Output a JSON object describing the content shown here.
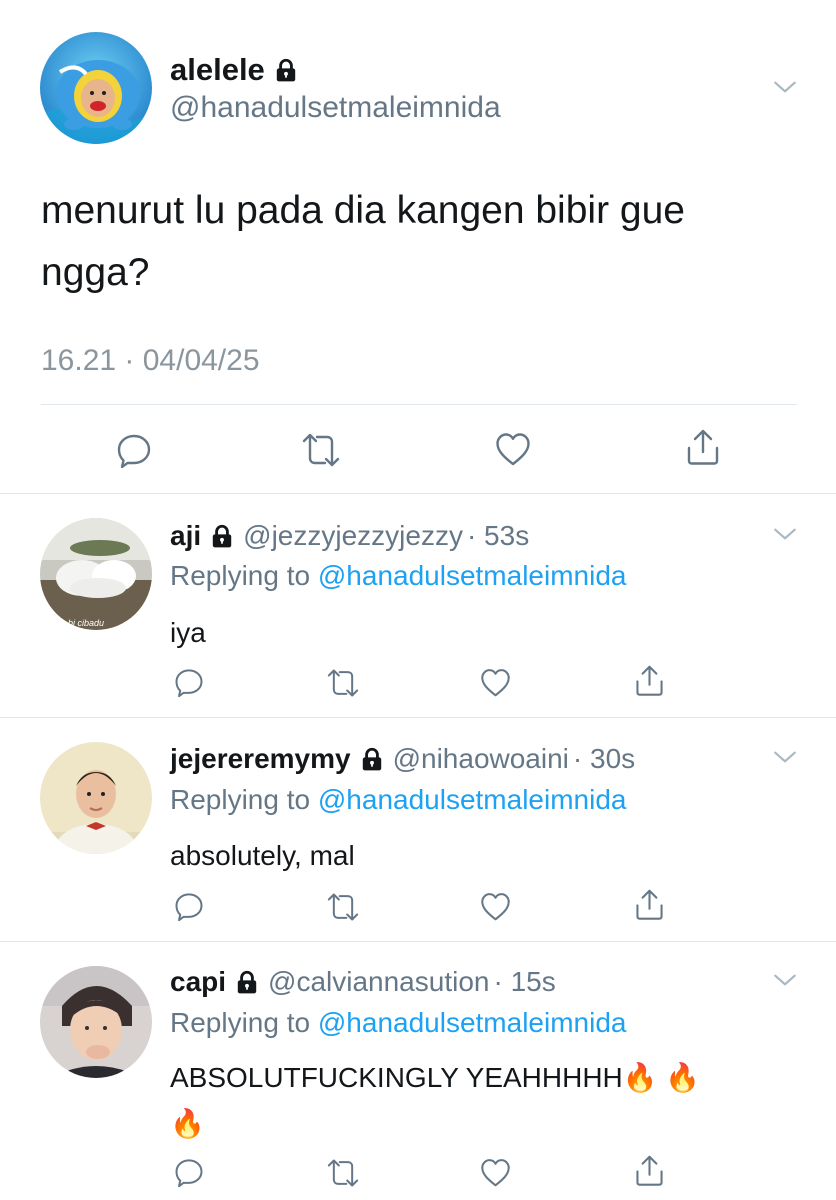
{
  "main_tweet": {
    "display_name": "alelele",
    "handle": "@hanadulsetmaleimnida",
    "text_line1": "menurut lu pada dia kangen bibir gue",
    "text_line2": "ngga?",
    "timestamp": "16.21 · 04/04/25"
  },
  "replies": [
    {
      "display_name": "aji",
      "handle": "@jezzyjezzyjezzy",
      "time": "· 53s",
      "replying_label": "Replying to",
      "replying_to": "@hanadulsetmaleimnida",
      "text_line1": "iya",
      "text_line2": "",
      "avatar_caption": "bi cibadu"
    },
    {
      "display_name": "jejereremymy",
      "handle": "@nihaowoaini",
      "time": "· 30s",
      "replying_label": "Replying to",
      "replying_to": "@hanadulsetmaleimnida",
      "text_line1": "absolutely, mal",
      "text_line2": ""
    },
    {
      "display_name": "capi",
      "handle": "@calviannasution",
      "time": "· 15s",
      "replying_label": "Replying to",
      "replying_to": "@hanadulsetmaleimnida",
      "text_line1": "ABSOLUTFUCKINGLY YEAHHHHH🔥 🔥",
      "text_line2": "🔥"
    }
  ],
  "icons": [
    "lock-icon",
    "chevron-down-icon",
    "reply-icon",
    "retweet-icon",
    "like-icon",
    "share-icon"
  ],
  "colors": {
    "link": "#1da1f2",
    "secondary": "#657786",
    "text": "#14171a"
  }
}
